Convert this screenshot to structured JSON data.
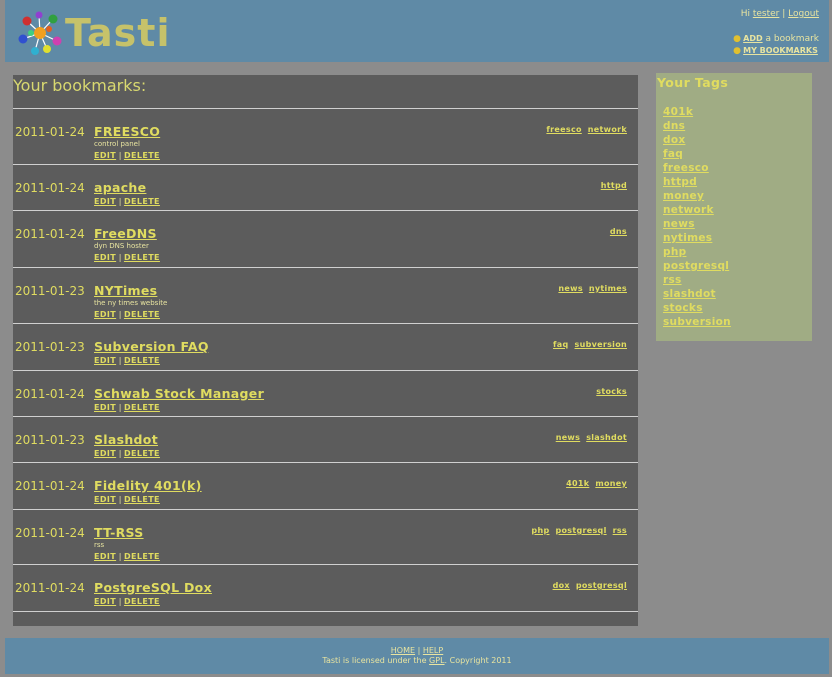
{
  "app": {
    "name": "Tasti"
  },
  "user": {
    "greeting": "Hi",
    "name": "tester",
    "sep": "|",
    "logout": "Logout"
  },
  "quicklinks": {
    "add_label": "ADD",
    "add_suffix": " a bookmark",
    "my_bookmarks": "MY BOOKMARKS"
  },
  "bookmarks": {
    "title": "Your bookmarks:",
    "edit_label": "EDIT",
    "delete_label": "DELETE",
    "sep": "|",
    "items": [
      {
        "date": "2011-01-24",
        "title": "FREESCO",
        "desc": "control panel",
        "tags": [
          "freesco",
          "network"
        ]
      },
      {
        "date": "2011-01-24",
        "title": "apache",
        "desc": "",
        "tags": [
          "httpd"
        ]
      },
      {
        "date": "2011-01-24",
        "title": "FreeDNS",
        "desc": "dyn DNS hoster",
        "tags": [
          "dns"
        ]
      },
      {
        "date": "2011-01-23",
        "title": "NYTimes",
        "desc": "the ny times website",
        "tags": [
          "news",
          "nytimes"
        ]
      },
      {
        "date": "2011-01-23",
        "title": "Subversion FAQ",
        "desc": "",
        "tags": [
          "faq",
          "subversion"
        ]
      },
      {
        "date": "2011-01-24",
        "title": "Schwab Stock Manager",
        "desc": "",
        "tags": [
          "stocks"
        ]
      },
      {
        "date": "2011-01-23",
        "title": "Slashdot",
        "desc": "",
        "tags": [
          "news",
          "slashdot"
        ]
      },
      {
        "date": "2011-01-24",
        "title": "Fidelity 401(k)",
        "desc": "",
        "tags": [
          "401k",
          "money"
        ]
      },
      {
        "date": "2011-01-24",
        "title": "TT-RSS",
        "desc": "rss",
        "tags": [
          "php",
          "postgresql",
          "rss"
        ]
      },
      {
        "date": "2011-01-24",
        "title": "PostgreSQL Dox",
        "desc": "",
        "tags": [
          "dox",
          "postgresql"
        ]
      }
    ]
  },
  "tags_panel": {
    "title": "Your Tags",
    "tags": [
      "401k",
      "dns",
      "dox",
      "faq",
      "freesco",
      "httpd",
      "money",
      "network",
      "news",
      "nytimes",
      "php",
      "postgresql",
      "rss",
      "slashdot",
      "stocks",
      "subversion"
    ]
  },
  "footer": {
    "home": "HOME",
    "sep": "|",
    "help": "HELP",
    "license_prefix": "Tasti is licensed under the ",
    "gpl": "GPL",
    "license_suffix": ". Copyright 2011"
  },
  "colors": {
    "header_bg": "#5f8aa6",
    "panel_bg": "#5c5c5c",
    "tags_bg": "#a0ac84",
    "link": "#e0dc60",
    "page_bg": "#8c8c8c"
  },
  "icons": {
    "logo": "colorful-molecule-logo-icon",
    "bullet": "yellow-bullet-icon"
  }
}
